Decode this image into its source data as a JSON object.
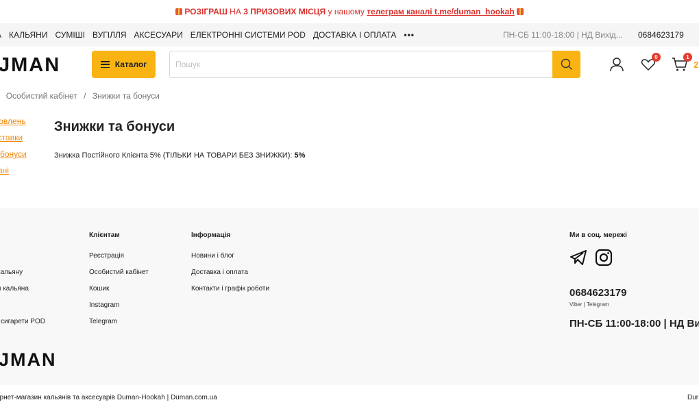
{
  "promo": {
    "prefix": "РОЗІГРАШ",
    "middle": " НА ",
    "bold": "3 ПРИЗОВИХ МІСЦЯ",
    "after": " у нашому ",
    "link": "телеграм каналі t.me/duman_hookah"
  },
  "topnav": {
    "items": [
      "А",
      "КАЛЬЯНИ",
      "СУМІШІ",
      "ВУГІЛЛЯ",
      "АКСЕСУАРИ",
      "ЕЛЕКТРОННІ СИСТЕМИ POD",
      "ДОСТАВКА І ОПЛАТА"
    ],
    "more": "•••",
    "hours": "ПН-СБ 11:00-18:00 | НД Вихід...",
    "phone": "0684623179"
  },
  "header": {
    "logo": "JMAN",
    "catalog_label": "Каталог",
    "search_placeholder": "Пошук",
    "favorites_count": "0",
    "cart_badge": "1",
    "cart_total": "2"
  },
  "breadcrumb": {
    "sep1": "/",
    "item1": "Особистий кабінет",
    "sep2": "/",
    "item2": "Знижки та бонуси"
  },
  "sidenav": [
    "мовлень",
    "оставки",
    "а бонуси",
    "дані"
  ],
  "content": {
    "title": "Знижки та бонуси",
    "text": "Знижка Постійного Клієнта 5% (ТІЛЬКИ НА ТОВАРИ БЕЗ ЗНИЖКИ): ",
    "value": "5%"
  },
  "footer": {
    "col0": [
      "кальяну",
      "я кальяна",
      "",
      "і сигарети POD"
    ],
    "clients_heading": "Клієнтам",
    "clients": [
      "Реєстрація",
      "Особистий кабінет",
      "Кошик",
      "Instagram",
      "Telegram"
    ],
    "info_heading": "Інформація",
    "info": [
      "Новини і блог",
      "Доставка і оплата",
      "Контакти і графік роботи"
    ],
    "social_heading": "Ми в соц. мережі",
    "phone": "0684623179",
    "phone_sub": "Viber | Telegram",
    "hours": "ПН-СБ 11:00-18:00 | НД Ви",
    "logo": "JMAN"
  },
  "bottom": {
    "copyright": "ернет-магазин кальянів та аксесуарів Duman-Hookah | Duman.com.ua",
    "right": "Dur"
  },
  "colors": {
    "accent": "#f9b413",
    "promo_red": "#d9302c",
    "link_orange": "#f08a12",
    "badge_red": "#e83b2f"
  },
  "icons": {
    "promo": "gift-icon",
    "search": "search-icon",
    "account": "user-icon",
    "favorites": "heart-icon",
    "cart": "cart-icon",
    "telegram": "telegram-icon",
    "instagram": "instagram-icon"
  }
}
